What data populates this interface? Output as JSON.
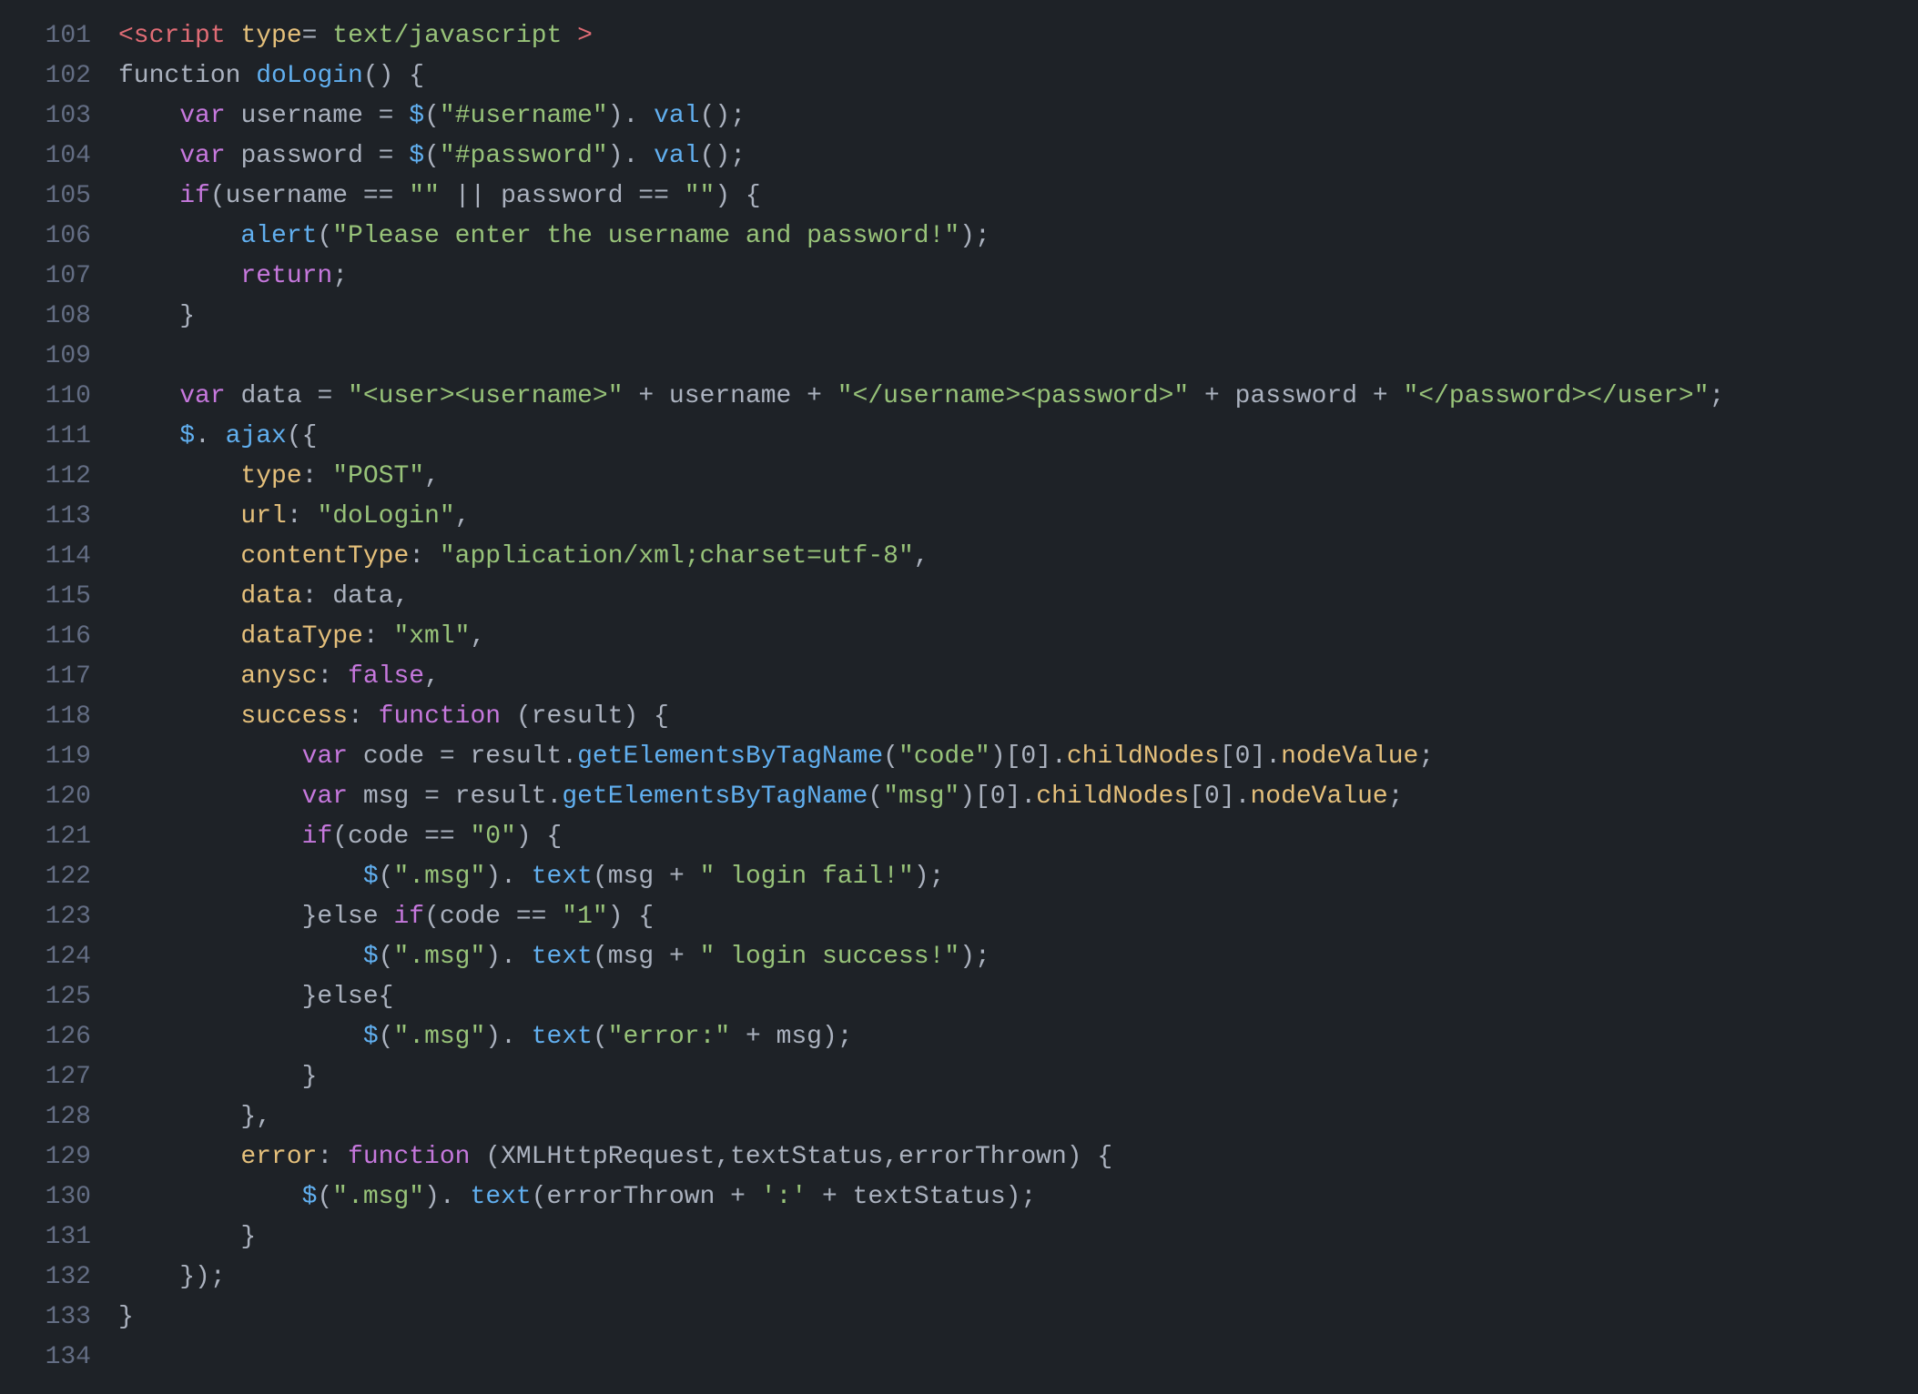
{
  "editor": {
    "background": "#1e2227",
    "lines": [
      {
        "num": "101",
        "tokens": [
          {
            "t": "tag",
            "v": "<script"
          },
          {
            "t": "plain",
            "v": " "
          },
          {
            "t": "attr",
            "v": "type"
          },
          {
            "t": "plain",
            "v": "= "
          },
          {
            "t": "string",
            "v": "text/javascript"
          },
          {
            "t": "plain",
            "v": " "
          },
          {
            "t": "tag",
            "v": ">"
          }
        ]
      },
      {
        "num": "102",
        "tokens": [
          {
            "t": "plain",
            "v": "function "
          },
          {
            "t": "func",
            "v": "doLogin"
          },
          {
            "t": "plain",
            "v": "() {"
          }
        ]
      },
      {
        "num": "103",
        "tokens": [
          {
            "t": "plain",
            "v": "    "
          },
          {
            "t": "keyword",
            "v": "var"
          },
          {
            "t": "plain",
            "v": " username = "
          },
          {
            "t": "func",
            "v": "$"
          },
          {
            "t": "plain",
            "v": "("
          },
          {
            "t": "string",
            "v": "\"#username\""
          },
          {
            "t": "plain",
            "v": "). "
          },
          {
            "t": "func",
            "v": "val"
          },
          {
            "t": "plain",
            "v": "();"
          }
        ]
      },
      {
        "num": "104",
        "tokens": [
          {
            "t": "plain",
            "v": "    "
          },
          {
            "t": "keyword",
            "v": "var"
          },
          {
            "t": "plain",
            "v": " password = "
          },
          {
            "t": "func",
            "v": "$"
          },
          {
            "t": "plain",
            "v": "("
          },
          {
            "t": "string",
            "v": "\"#password\""
          },
          {
            "t": "plain",
            "v": "). "
          },
          {
            "t": "func",
            "v": "val"
          },
          {
            "t": "plain",
            "v": "();"
          }
        ]
      },
      {
        "num": "105",
        "tokens": [
          {
            "t": "plain",
            "v": "    "
          },
          {
            "t": "keyword",
            "v": "if"
          },
          {
            "t": "plain",
            "v": "(username == "
          },
          {
            "t": "string",
            "v": "\"\""
          },
          {
            "t": "plain",
            "v": " || password == "
          },
          {
            "t": "string",
            "v": "\"\""
          },
          {
            "t": "plain",
            "v": ") {"
          }
        ]
      },
      {
        "num": "106",
        "tokens": [
          {
            "t": "plain",
            "v": "        "
          },
          {
            "t": "func",
            "v": "alert"
          },
          {
            "t": "plain",
            "v": "("
          },
          {
            "t": "string",
            "v": "\"Please enter the username and password!\""
          },
          {
            "t": "plain",
            "v": ");"
          }
        ]
      },
      {
        "num": "107",
        "tokens": [
          {
            "t": "plain",
            "v": "        "
          },
          {
            "t": "keyword",
            "v": "return"
          },
          {
            "t": "plain",
            "v": ";"
          }
        ]
      },
      {
        "num": "108",
        "tokens": [
          {
            "t": "plain",
            "v": "    }"
          }
        ]
      },
      {
        "num": "109",
        "tokens": []
      },
      {
        "num": "110",
        "tokens": [
          {
            "t": "plain",
            "v": "    "
          },
          {
            "t": "keyword",
            "v": "var"
          },
          {
            "t": "plain",
            "v": " data = "
          },
          {
            "t": "string",
            "v": "\"<user><username>\""
          },
          {
            "t": "plain",
            "v": " + username + "
          },
          {
            "t": "string",
            "v": "\"</username><password>\""
          },
          {
            "t": "plain",
            "v": " + password + "
          },
          {
            "t": "string",
            "v": "\"</password></user>\""
          },
          {
            "t": "plain",
            "v": ";"
          }
        ]
      },
      {
        "num": "111",
        "tokens": [
          {
            "t": "plain",
            "v": "    "
          },
          {
            "t": "func",
            "v": "$"
          },
          {
            "t": "plain",
            "v": ". "
          },
          {
            "t": "func",
            "v": "ajax"
          },
          {
            "t": "plain",
            "v": "({"
          }
        ]
      },
      {
        "num": "112",
        "tokens": [
          {
            "t": "plain",
            "v": "        "
          },
          {
            "t": "prop",
            "v": "type"
          },
          {
            "t": "plain",
            "v": ": "
          },
          {
            "t": "string",
            "v": "\"POST\""
          },
          {
            "t": "plain",
            "v": ","
          }
        ]
      },
      {
        "num": "113",
        "tokens": [
          {
            "t": "plain",
            "v": "        "
          },
          {
            "t": "prop",
            "v": "url"
          },
          {
            "t": "plain",
            "v": ": "
          },
          {
            "t": "string",
            "v": "\"doLogin\""
          },
          {
            "t": "plain",
            "v": ","
          }
        ]
      },
      {
        "num": "114",
        "tokens": [
          {
            "t": "plain",
            "v": "        "
          },
          {
            "t": "prop",
            "v": "contentType"
          },
          {
            "t": "plain",
            "v": ": "
          },
          {
            "t": "string",
            "v": "\"application/xml;charset=utf-8\""
          },
          {
            "t": "plain",
            "v": ","
          }
        ]
      },
      {
        "num": "115",
        "tokens": [
          {
            "t": "plain",
            "v": "        "
          },
          {
            "t": "prop",
            "v": "data"
          },
          {
            "t": "plain",
            "v": ": data,"
          }
        ]
      },
      {
        "num": "116",
        "tokens": [
          {
            "t": "plain",
            "v": "        "
          },
          {
            "t": "prop",
            "v": "dataType"
          },
          {
            "t": "plain",
            "v": ": "
          },
          {
            "t": "string",
            "v": "\"xml\""
          },
          {
            "t": "plain",
            "v": ","
          }
        ]
      },
      {
        "num": "117",
        "tokens": [
          {
            "t": "plain",
            "v": "        "
          },
          {
            "t": "prop",
            "v": "anysc"
          },
          {
            "t": "plain",
            "v": ": "
          },
          {
            "t": "keyword",
            "v": "false"
          },
          {
            "t": "plain",
            "v": ","
          }
        ]
      },
      {
        "num": "118",
        "tokens": [
          {
            "t": "plain",
            "v": "        "
          },
          {
            "t": "prop",
            "v": "success"
          },
          {
            "t": "plain",
            "v": ": "
          },
          {
            "t": "keyword",
            "v": "function"
          },
          {
            "t": "plain",
            "v": " (result) {"
          }
        ]
      },
      {
        "num": "119",
        "tokens": [
          {
            "t": "plain",
            "v": "            "
          },
          {
            "t": "keyword",
            "v": "var"
          },
          {
            "t": "plain",
            "v": " code = result."
          },
          {
            "t": "func",
            "v": "getElementsByTagName"
          },
          {
            "t": "plain",
            "v": "("
          },
          {
            "t": "string",
            "v": "\"code\""
          },
          {
            "t": "plain",
            "v": ")[0]."
          },
          {
            "t": "prop",
            "v": "childNodes"
          },
          {
            "t": "plain",
            "v": "[0]."
          },
          {
            "t": "prop",
            "v": "nodeValue"
          },
          {
            "t": "plain",
            "v": ";"
          }
        ]
      },
      {
        "num": "120",
        "tokens": [
          {
            "t": "plain",
            "v": "            "
          },
          {
            "t": "keyword",
            "v": "var"
          },
          {
            "t": "plain",
            "v": " msg = result."
          },
          {
            "t": "func",
            "v": "getElementsByTagName"
          },
          {
            "t": "plain",
            "v": "("
          },
          {
            "t": "string",
            "v": "\"msg\""
          },
          {
            "t": "plain",
            "v": ")[0]."
          },
          {
            "t": "prop",
            "v": "childNodes"
          },
          {
            "t": "plain",
            "v": "[0]."
          },
          {
            "t": "prop",
            "v": "nodeValue"
          },
          {
            "t": "plain",
            "v": ";"
          }
        ]
      },
      {
        "num": "121",
        "tokens": [
          {
            "t": "plain",
            "v": "            "
          },
          {
            "t": "keyword",
            "v": "if"
          },
          {
            "t": "plain",
            "v": "(code == "
          },
          {
            "t": "string",
            "v": "\"0\""
          },
          {
            "t": "plain",
            "v": ") {"
          }
        ]
      },
      {
        "num": "122",
        "tokens": [
          {
            "t": "plain",
            "v": "                "
          },
          {
            "t": "func",
            "v": "$"
          },
          {
            "t": "plain",
            "v": "("
          },
          {
            "t": "string",
            "v": "\".msg\""
          },
          {
            "t": "plain",
            "v": "). "
          },
          {
            "t": "func",
            "v": "text"
          },
          {
            "t": "plain",
            "v": "(msg + "
          },
          {
            "t": "string",
            "v": "\" login fail!\""
          },
          {
            "t": "plain",
            "v": ");"
          }
        ]
      },
      {
        "num": "123",
        "tokens": [
          {
            "t": "plain",
            "v": "            }else "
          },
          {
            "t": "keyword",
            "v": "if"
          },
          {
            "t": "plain",
            "v": "(code == "
          },
          {
            "t": "string",
            "v": "\"1\""
          },
          {
            "t": "plain",
            "v": ") {"
          }
        ]
      },
      {
        "num": "124",
        "tokens": [
          {
            "t": "plain",
            "v": "                "
          },
          {
            "t": "func",
            "v": "$"
          },
          {
            "t": "plain",
            "v": "("
          },
          {
            "t": "string",
            "v": "\".msg\""
          },
          {
            "t": "plain",
            "v": "). "
          },
          {
            "t": "func",
            "v": "text"
          },
          {
            "t": "plain",
            "v": "(msg + "
          },
          {
            "t": "string",
            "v": "\" login success!\""
          },
          {
            "t": "plain",
            "v": ");"
          }
        ]
      },
      {
        "num": "125",
        "tokens": [
          {
            "t": "plain",
            "v": "            }else{"
          }
        ]
      },
      {
        "num": "126",
        "tokens": [
          {
            "t": "plain",
            "v": "                "
          },
          {
            "t": "func",
            "v": "$"
          },
          {
            "t": "plain",
            "v": "("
          },
          {
            "t": "string",
            "v": "\".msg\""
          },
          {
            "t": "plain",
            "v": "). "
          },
          {
            "t": "func",
            "v": "text"
          },
          {
            "t": "plain",
            "v": "("
          },
          {
            "t": "string",
            "v": "\"error:\""
          },
          {
            "t": "plain",
            "v": " + msg);"
          }
        ]
      },
      {
        "num": "127",
        "tokens": [
          {
            "t": "plain",
            "v": "            }"
          }
        ]
      },
      {
        "num": "128",
        "tokens": [
          {
            "t": "plain",
            "v": "        },"
          }
        ]
      },
      {
        "num": "129",
        "tokens": [
          {
            "t": "plain",
            "v": "        "
          },
          {
            "t": "prop",
            "v": "error"
          },
          {
            "t": "plain",
            "v": ": "
          },
          {
            "t": "keyword",
            "v": "function"
          },
          {
            "t": "plain",
            "v": " (XMLHttpRequest,textStatus,errorThrown) {"
          }
        ]
      },
      {
        "num": "130",
        "tokens": [
          {
            "t": "plain",
            "v": "            "
          },
          {
            "t": "func",
            "v": "$"
          },
          {
            "t": "plain",
            "v": "("
          },
          {
            "t": "string",
            "v": "\".msg\""
          },
          {
            "t": "plain",
            "v": "). "
          },
          {
            "t": "func",
            "v": "text"
          },
          {
            "t": "plain",
            "v": "(errorThrown + "
          },
          {
            "t": "string",
            "v": "':'"
          },
          {
            "t": "plain",
            "v": " + textStatus);"
          }
        ]
      },
      {
        "num": "131",
        "tokens": [
          {
            "t": "plain",
            "v": "        }"
          }
        ]
      },
      {
        "num": "132",
        "tokens": [
          {
            "t": "plain",
            "v": "    });"
          }
        ]
      },
      {
        "num": "133",
        "tokens": [
          {
            "t": "plain",
            "v": "}"
          }
        ]
      },
      {
        "num": "134",
        "tokens": [
          {
            "t": "plain",
            "v": ""
          }
        ]
      }
    ]
  }
}
